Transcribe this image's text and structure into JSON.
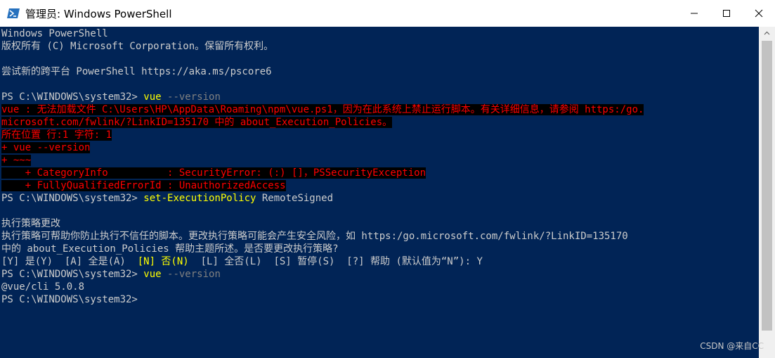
{
  "window": {
    "title": "管理员: Windows PowerShell"
  },
  "console": {
    "lines": {
      "l1": "Windows PowerShell",
      "l2": "版权所有 (C) Microsoft Corporation。保留所有权利。",
      "l3": "尝试新的跨平台 PowerShell https://aka.ms/pscore6",
      "l4_prompt": "PS C:\\WINDOWS\\system32> ",
      "l4_cmd": "vue",
      "l4_param": " --version",
      "l5": "vue : 无法加载文件 C:\\Users\\HP\\AppData\\Roaming\\npm\\vue.ps1，因为在此系统上禁止运行脚本。有关详细信息，请参阅 https:/go.",
      "l6": "microsoft.com/fwlink/?LinkID=135170 中的 about_Execution_Policies。",
      "l7": "所在位置 行:1 字符: 1",
      "l8": "+ vue --version",
      "l9": "+ ~~~",
      "l10": "    + CategoryInfo          : SecurityError: (:) []，PSSecurityException",
      "l11": "    + FullyQualifiedErrorId : UnauthorizedAccess",
      "l12_prompt": "PS C:\\WINDOWS\\system32> ",
      "l12_cmd": "set-ExecutionPolicy",
      "l12_arg": " RemoteSigned",
      "l13": "执行策略更改",
      "l14": "执行策略可帮助你防止执行不信任的脚本。更改执行策略可能会产生安全风险，如 https:/go.microsoft.com/fwlink/?LinkID=135170",
      "l15": "中的 about_Execution_Policies 帮助主题所述。是否要更改执行策略?",
      "l16_a": "[Y] 是(Y)  [A] 全是(A)  ",
      "l16_b": "[N] 否(N)",
      "l16_c": "  [L] 全否(L)  [S] 暂停(S)  [?] 帮助 (默认值为“N”): Y",
      "l17_prompt": "PS C:\\WINDOWS\\system32> ",
      "l17_cmd": "vue",
      "l17_param": " --version",
      "l18": "@vue/cli 5.0.8",
      "l19": "PS C:\\WINDOWS\\system32>"
    }
  },
  "watermark": "CSDN @来自CC"
}
